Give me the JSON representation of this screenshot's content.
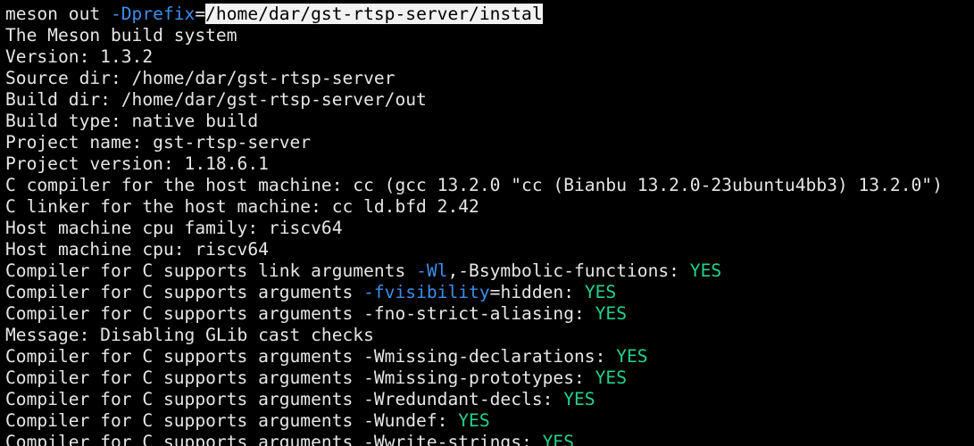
{
  "colors": {
    "background": "#000000",
    "foreground": "#e6e6e6",
    "option_blue": "#3b8eea",
    "yes_green": "#23d18b",
    "selection_bg": "#f2f2f2",
    "selection_fg": "#000000"
  },
  "lines": [
    [
      {
        "t": "meson out "
      },
      {
        "t": "-Dprefix",
        "c": "blue"
      },
      {
        "t": "="
      },
      {
        "t": "/home/dar/gst-rtsp-server/instal",
        "c": "sel"
      }
    ],
    [
      {
        "t": "The Meson build system"
      }
    ],
    [
      {
        "t": "Version: 1.3.2"
      }
    ],
    [
      {
        "t": "Source dir: /home/dar/gst-rtsp-server"
      }
    ],
    [
      {
        "t": "Build dir: /home/dar/gst-rtsp-server/out"
      }
    ],
    [
      {
        "t": "Build type: native build"
      }
    ],
    [
      {
        "t": "Project name: gst-rtsp-server"
      }
    ],
    [
      {
        "t": "Project version: 1.18.6.1"
      }
    ],
    [
      {
        "t": "C compiler for the host machine: cc (gcc 13.2.0 \"cc (Bianbu 13.2.0-23ubuntu4bb3) 13.2.0\")"
      }
    ],
    [
      {
        "t": "C linker for the host machine: cc ld.bfd 2.42"
      }
    ],
    [
      {
        "t": "Host machine cpu family: riscv64"
      }
    ],
    [
      {
        "t": "Host machine cpu: riscv64"
      }
    ],
    [
      {
        "t": "Compiler for C supports link arguments "
      },
      {
        "t": "-Wl",
        "c": "blue"
      },
      {
        "t": ",-Bsymbolic-functions: "
      },
      {
        "t": "YES",
        "c": "green"
      }
    ],
    [
      {
        "t": "Compiler for C supports arguments "
      },
      {
        "t": "-fvisibility",
        "c": "blue"
      },
      {
        "t": "=hidden: "
      },
      {
        "t": "YES",
        "c": "green"
      }
    ],
    [
      {
        "t": "Compiler for C supports arguments -fno-strict-aliasing: "
      },
      {
        "t": "YES",
        "c": "green"
      }
    ],
    [
      {
        "t": "Message: Disabling GLib cast checks"
      }
    ],
    [
      {
        "t": "Compiler for C supports arguments -Wmissing-declarations: "
      },
      {
        "t": "YES",
        "c": "green"
      }
    ],
    [
      {
        "t": "Compiler for C supports arguments -Wmissing-prototypes: "
      },
      {
        "t": "YES",
        "c": "green"
      }
    ],
    [
      {
        "t": "Compiler for C supports arguments -Wredundant-decls: "
      },
      {
        "t": "YES",
        "c": "green"
      }
    ],
    [
      {
        "t": "Compiler for C supports arguments -Wundef: "
      },
      {
        "t": "YES",
        "c": "green"
      }
    ],
    [
      {
        "t": "Compiler for C supports arguments -Wwrite-strings: "
      },
      {
        "t": "YES",
        "c": "green"
      }
    ]
  ]
}
